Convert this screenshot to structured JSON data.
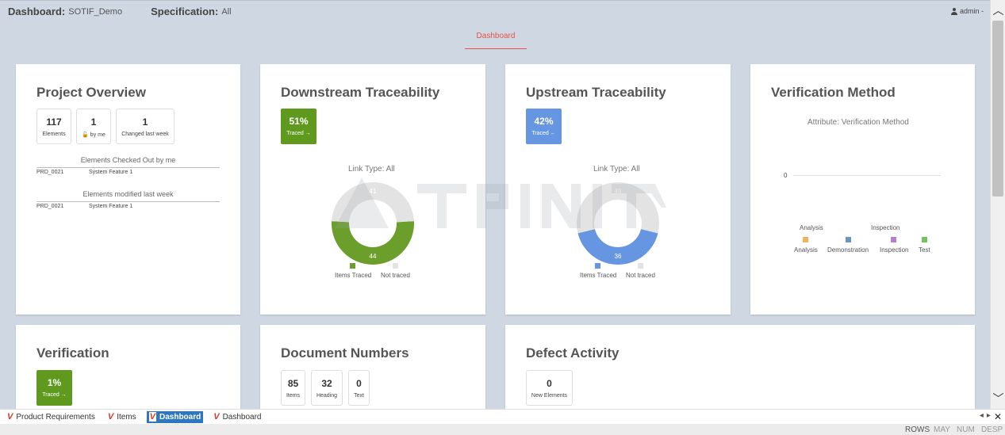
{
  "header": {
    "dashboard_label": "Dashboard:",
    "dashboard_value": "SOTIF_Demo",
    "spec_label": "Specification:",
    "spec_value": "All",
    "user": "admin -"
  },
  "active_tab": "Dashboard",
  "project_overview": {
    "title": "Project Overview",
    "stats": [
      {
        "value": "117",
        "label": "Elements"
      },
      {
        "value": "1",
        "label": "by me"
      },
      {
        "value": "1",
        "label": "Changed last week"
      }
    ],
    "checked_out_title": "Elements Checked Out by me",
    "checked_out_rows": [
      {
        "id": "PRD_0021",
        "name": "System Feature 1"
      }
    ],
    "modified_title": "Elements modified last week",
    "modified_rows": [
      {
        "id": "PRD_0021",
        "name": "System Feature 1"
      }
    ]
  },
  "downstream": {
    "title": "Downstream Traceability",
    "percent": "51%",
    "badge_label": "Traced",
    "badge_arrow": "→",
    "link_type": "Link Type:  All",
    "traced": 44,
    "not_traced": 41,
    "legend_traced": "Items Traced",
    "legend_not": "Not traced",
    "color_traced": "#6b9e2a",
    "color_not": "#e3e3e3"
  },
  "upstream": {
    "title": "Upstream Traceability",
    "percent": "42%",
    "badge_label": "Traced",
    "badge_arrow": "←",
    "link_type": "Link Type:  All",
    "traced": 36,
    "not_traced": 49,
    "legend_traced": "Items Traced",
    "legend_not": "Not traced",
    "color_traced": "#6695e2",
    "color_not": "#e3e3e3"
  },
  "verification_method": {
    "title": "Verification Method",
    "attribute": "Attribute:  Verification Method",
    "zero_tick": "0",
    "top_labels": [
      "Analysis",
      "Inspection"
    ],
    "legend": [
      {
        "label": "Analysis",
        "color": "#f3b35d"
      },
      {
        "label": "Demonstration",
        "color": "#6b95c2"
      },
      {
        "label": "Inspection",
        "color": "#b77dd3"
      },
      {
        "label": "Test",
        "color": "#74c25e"
      }
    ]
  },
  "verification": {
    "title": "Verification",
    "percent": "1%",
    "badge_label": "Traced",
    "badge_arrow": "→"
  },
  "document_numbers": {
    "title": "Document Numbers",
    "stats": [
      {
        "value": "85",
        "label": "Items"
      },
      {
        "value": "32",
        "label": "Heading"
      },
      {
        "value": "0",
        "label": "Text"
      }
    ]
  },
  "defect_activity": {
    "title": "Defect Activity",
    "stats": [
      {
        "value": "0",
        "label": "New Elements"
      }
    ]
  },
  "bottom_tabs": [
    {
      "label": "Product Requirements"
    },
    {
      "label": "Items"
    },
    {
      "label": "Dashboard"
    },
    {
      "label": "Dashboard"
    }
  ],
  "status": {
    "rows": "ROWS",
    "may": "MAY",
    "num": "NUM",
    "desp": "DESP"
  }
}
